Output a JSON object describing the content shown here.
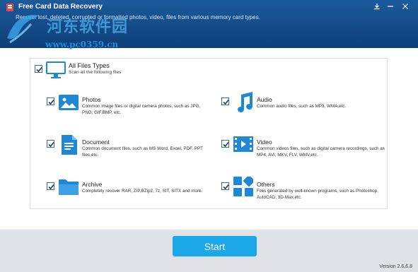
{
  "app": {
    "title": "Free Card Data Recovery",
    "subtitle": "Recover lost, deleted, corrupted or formatted photos, video, files from various memory card types.",
    "version": "Version 2.6.6.8"
  },
  "watermark": {
    "line1": "河东软件园",
    "line2": "www.pc0359.cn"
  },
  "all_files": {
    "title": "All Files Types",
    "desc": "Scan all the following files",
    "checked": true
  },
  "file_types": [
    {
      "id": "photos",
      "title": "Photos",
      "desc": "Common image files or digital camera photos, such as JPG, PNG, GIF,BMP, etc.",
      "icon": "photo-icon",
      "checked": true
    },
    {
      "id": "audio",
      "title": "Audio",
      "desc": "Common audio files, such as MP3, WMA,etc.",
      "icon": "music-note-icon",
      "checked": true
    },
    {
      "id": "document",
      "title": "Document",
      "desc": "Common document files, such as MS Word, Excel, PDF, PPT files,etc.",
      "icon": "document-icon",
      "checked": true
    },
    {
      "id": "video",
      "title": "Video",
      "desc": "Common videos files, such as digital camera recordings, such as MP4, AVI, MKV, FLV, WMV,etc.",
      "icon": "video-icon",
      "checked": true
    },
    {
      "id": "archive",
      "title": "Archive",
      "desc": "Completely recover RAR, ZIP,BZip2, 7z, SIT, SITX and more.",
      "icon": "folder-icon",
      "checked": true
    },
    {
      "id": "others",
      "title": "Others",
      "desc": "Files generated by well-known programs, such as Photoshop, AutoCAD, 3D-Max,etc.",
      "icon": "others-icon",
      "checked": true
    }
  ],
  "start_button": {
    "label": "Start"
  },
  "colors": {
    "header": "#1b5a9c",
    "accent": "#1ba7e8",
    "icon_blue": "#1e88d6"
  }
}
